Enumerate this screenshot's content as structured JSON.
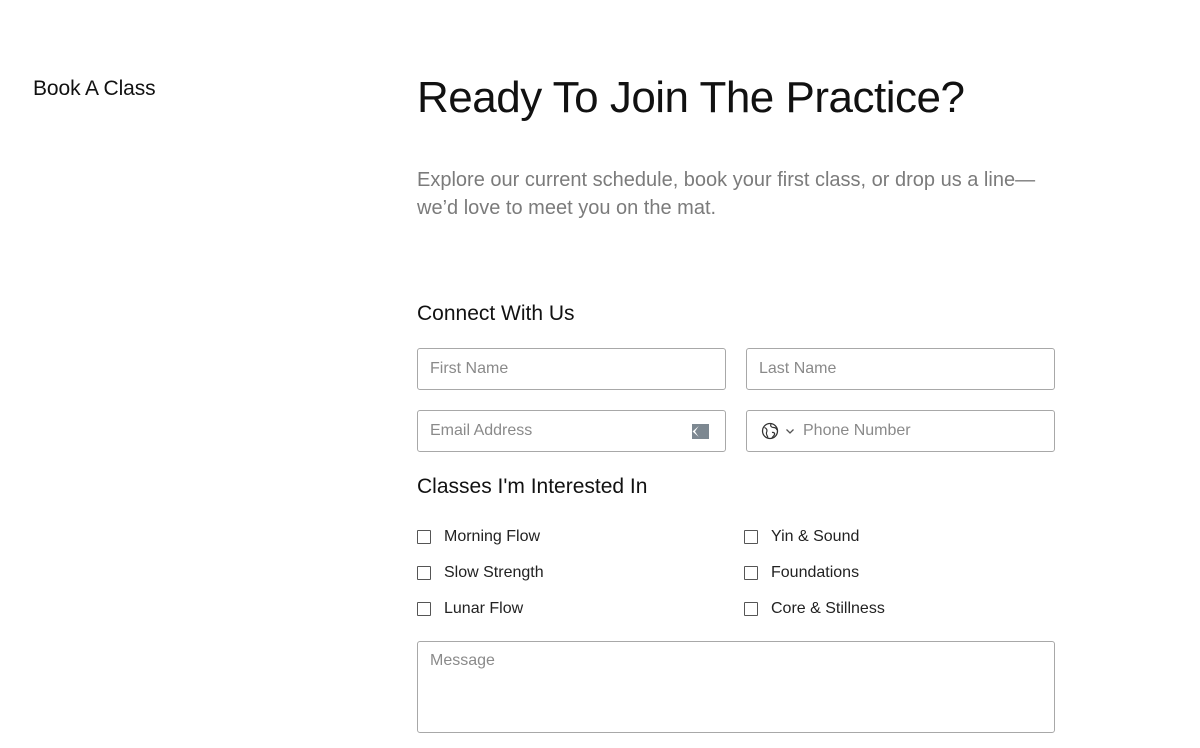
{
  "sidebar": {
    "label": "Book A Class"
  },
  "hero": {
    "title": "Ready To Join The Practice?",
    "intro": "Explore our current schedule, book your first class, or drop us a line—we’d love to meet you on the mat."
  },
  "form": {
    "connect_title": "Connect With Us",
    "first_name": {
      "placeholder": "First Name",
      "value": ""
    },
    "last_name": {
      "placeholder": "Last Name",
      "value": ""
    },
    "email": {
      "placeholder": "Email Address",
      "value": ""
    },
    "phone": {
      "placeholder": "Phone Number",
      "value": ""
    },
    "classes_title": "Classes I'm Interested In",
    "classes": [
      {
        "label": "Morning Flow",
        "checked": false
      },
      {
        "label": "Yin & Sound",
        "checked": false
      },
      {
        "label": "Slow Strength",
        "checked": false
      },
      {
        "label": "Foundations",
        "checked": false
      },
      {
        "label": "Lunar Flow",
        "checked": false
      },
      {
        "label": "Core & Stillness",
        "checked": false
      }
    ],
    "message": {
      "placeholder": "Message",
      "value": ""
    }
  },
  "icons": {
    "email_autofill": "password-manager-autofill-icon",
    "country": "globe-icon",
    "country_dropdown": "chevron-down-icon"
  },
  "colors": {
    "text": "#111111",
    "muted_text": "#7b7b7b",
    "field_border": "#a8a8a8",
    "placeholder": "#8a8a8a"
  }
}
